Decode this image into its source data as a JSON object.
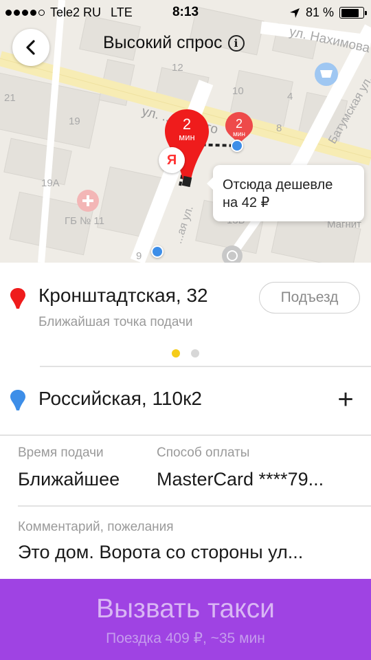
{
  "status_bar": {
    "carrier": "Tele2 RU",
    "network": "LTE",
    "time": "8:13",
    "battery": "81 %",
    "battery_level": 0.81
  },
  "header": {
    "title": "Высокий спрос",
    "back_icon": "chevron-left-icon",
    "info_icon": "info-icon"
  },
  "map": {
    "street_labels": [
      "ул. Нахимова",
      "Батумская ул.",
      "ул. ...инского",
      "...ая ул."
    ],
    "house_numbers": [
      "12",
      "10",
      "4",
      "8",
      "21",
      "19",
      "19А",
      "9",
      "13Б"
    ],
    "place_labels": [
      "ГБ № 11",
      "Магнит"
    ],
    "pickup_pin": {
      "value": "2",
      "unit": "мин"
    },
    "alt_pin": {
      "value": "2",
      "unit": "мин"
    },
    "provider_logo": "Я",
    "cheaper_tooltip": {
      "line1": "Отсюда дешевле",
      "line2": "на 42 ₽"
    }
  },
  "pickup": {
    "address": "Кронштадтская, 32",
    "hint": "Ближайшая точка подачи",
    "entrance_button": "Подъезд",
    "pages": 2,
    "active_page": 1
  },
  "destination": {
    "address": "Российская, 110к2",
    "add_label": "+"
  },
  "details": {
    "time_label": "Время подачи",
    "time_value": "Ближайшее",
    "payment_label": "Способ оплаты",
    "payment_value": "MasterCard ****79...",
    "comment_label": "Комментарий, пожелания",
    "comment_value": "Это дом. Ворота со стороны ул..."
  },
  "order_button": {
    "title": "Вызвать такси",
    "subtitle": "Поездка 409 ₽, ~35 мин"
  },
  "colors": {
    "accent_purple": "#9f43e3",
    "pin_red": "#ef1c1c",
    "pin_blue": "#3d8ee8",
    "page_dot_active": "#f5cc19"
  }
}
